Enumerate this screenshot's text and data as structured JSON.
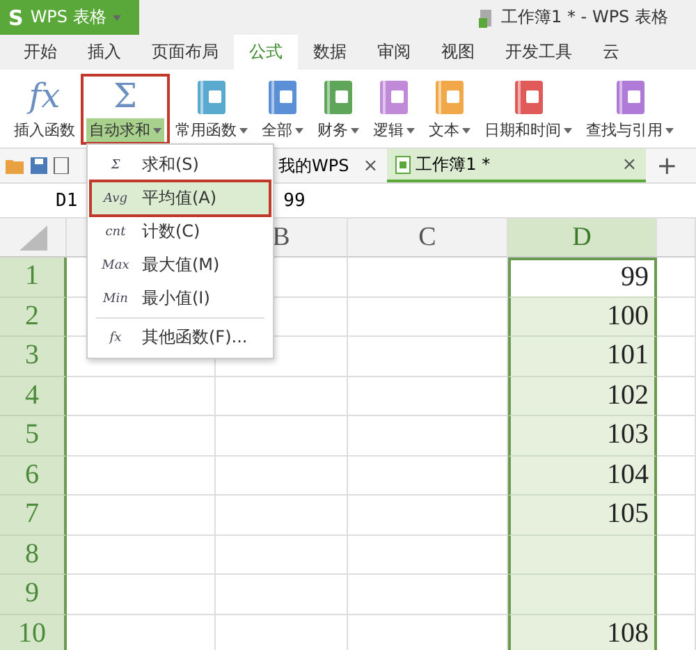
{
  "app_button": {
    "logo": "S",
    "label": "WPS 表格"
  },
  "window": {
    "title": "工作簿1 * - WPS 表格"
  },
  "tabs": [
    {
      "label": "开始",
      "selected": false
    },
    {
      "label": "插入",
      "selected": false
    },
    {
      "label": "页面布局",
      "selected": false
    },
    {
      "label": "公式",
      "selected": true
    },
    {
      "label": "数据",
      "selected": false
    },
    {
      "label": "审阅",
      "selected": false
    },
    {
      "label": "视图",
      "selected": false
    },
    {
      "label": "开发工具",
      "selected": false
    },
    {
      "label": "云",
      "selected": false
    }
  ],
  "ribbon": [
    {
      "kind": "glyph",
      "glyph": "fx",
      "label": "插入函数",
      "dropdown": false,
      "pressed": false
    },
    {
      "kind": "glyph",
      "glyph": "Σ",
      "label": "自动求和",
      "dropdown": true,
      "pressed": true
    },
    {
      "kind": "book",
      "color": "#5aaad0",
      "label": "常用函数",
      "dropdown": true,
      "pressed": false
    },
    {
      "kind": "book",
      "color": "#5b8fd6",
      "label": "全部",
      "dropdown": true,
      "pressed": false
    },
    {
      "kind": "book",
      "color": "#5fa55a",
      "label": "财务",
      "dropdown": true,
      "pressed": false
    },
    {
      "kind": "book",
      "color": "#c08ad8",
      "label": "逻辑",
      "dropdown": true,
      "pressed": false
    },
    {
      "kind": "book",
      "color": "#f0a848",
      "label": "文本",
      "dropdown": true,
      "pressed": false
    },
    {
      "kind": "book",
      "color": "#e05a5a",
      "label": "日期和时间",
      "dropdown": true,
      "pressed": false
    },
    {
      "kind": "book",
      "color": "#b07ad8",
      "label": "查找与引用",
      "dropdown": true,
      "pressed": false
    }
  ],
  "doc_tabs": [
    {
      "label": "我的WPS",
      "close": "×",
      "selected": false
    },
    {
      "label": "工作簿1 *",
      "close": "×",
      "selected": true
    }
  ],
  "new_tab": "+",
  "formula_bar": {
    "cell": "D1",
    "value": "99"
  },
  "sheet": {
    "columns": [
      {
        "label": "B",
        "selected": false
      },
      {
        "label": "C",
        "selected": false
      },
      {
        "label": "D",
        "selected": true
      }
    ],
    "rows": [
      {
        "header": "1",
        "d": "99",
        "active": true
      },
      {
        "header": "2",
        "d": "100",
        "active": false
      },
      {
        "header": "3",
        "d": "101",
        "active": false
      },
      {
        "header": "4",
        "d": "102",
        "active": false
      },
      {
        "header": "5",
        "d": "103",
        "active": false
      },
      {
        "header": "6",
        "d": "104",
        "active": false
      },
      {
        "header": "7",
        "d": "105",
        "active": false
      },
      {
        "header": "8",
        "active": false
      },
      {
        "header": "9",
        "active": false
      },
      {
        "header": "10",
        "d": "108",
        "active": false
      }
    ]
  },
  "menu": {
    "items": [
      {
        "icon": "Σ",
        "label": "求和(S)",
        "highlighted": false,
        "separator_before": false
      },
      {
        "icon": "Avg",
        "label": "平均值(A)",
        "highlighted": true,
        "separator_before": false
      },
      {
        "icon": "cnt",
        "label": "计数(C)",
        "highlighted": false,
        "separator_before": false
      },
      {
        "icon": "Max",
        "label": "最大值(M)",
        "highlighted": false,
        "separator_before": false
      },
      {
        "icon": "Min",
        "label": "最小值(I)",
        "highlighted": false,
        "separator_before": false
      },
      {
        "icon": "fx",
        "label": "其他函数(F)...",
        "highlighted": false,
        "separator_before": true
      }
    ]
  }
}
